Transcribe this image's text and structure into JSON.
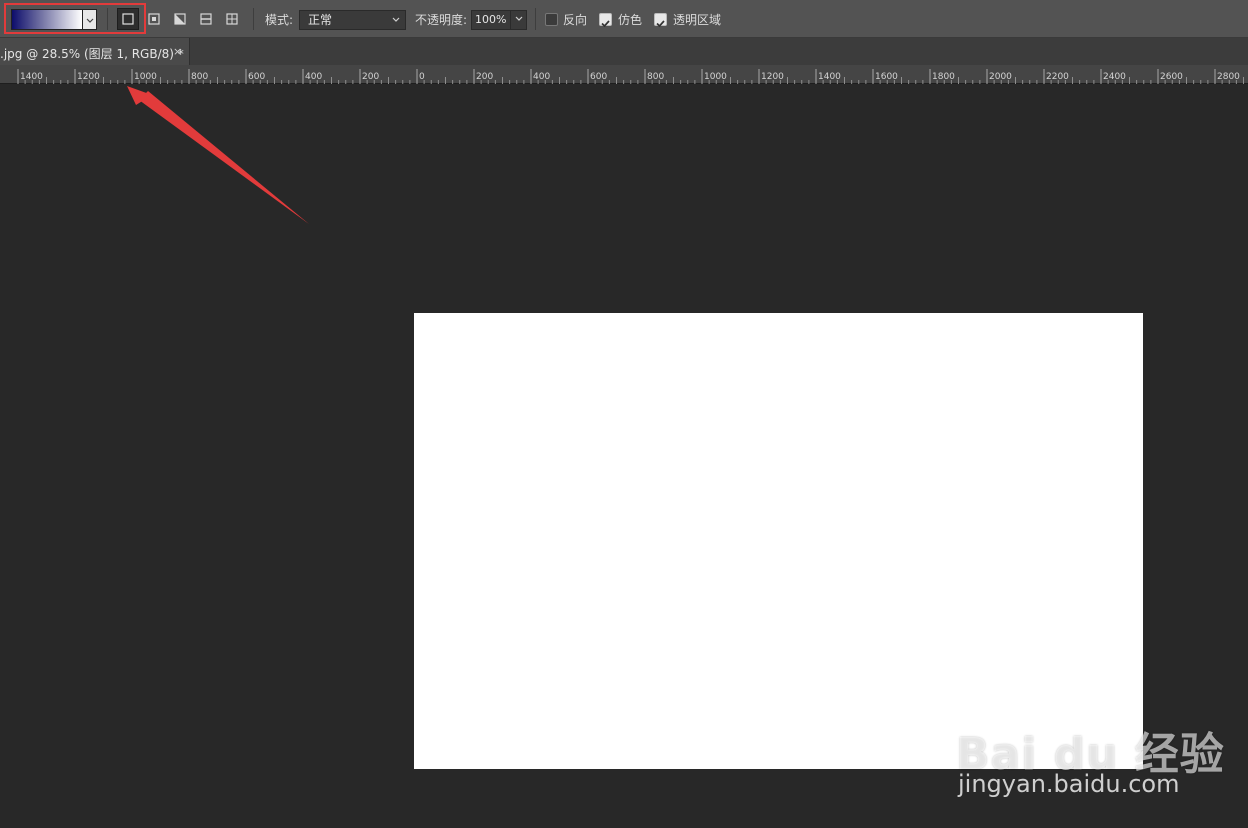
{
  "options_bar": {
    "gradient_preset": "navy-to-white gradient swatch",
    "gradient_colors": [
      "#0d0d6b",
      "#ffffff"
    ],
    "gradient_types": [
      {
        "name": "linear-gradient",
        "active": true
      },
      {
        "name": "radial-gradient",
        "active": false
      },
      {
        "name": "angle-gradient",
        "active": false
      },
      {
        "name": "reflected-gradient",
        "active": false
      },
      {
        "name": "diamond-gradient",
        "active": false
      }
    ],
    "mode_label": "模式:",
    "mode_value": "正常",
    "opacity_label": "不透明度:",
    "opacity_value": "100%",
    "reverse_label": "反向",
    "reverse_checked": false,
    "dither_label": "仿色",
    "dither_checked": true,
    "transparency_label": "透明区域",
    "transparency_checked": true,
    "highlight_color": "#e23b3b"
  },
  "document_tab": {
    "title": ".jpg @ 28.5% (图层 1, RGB/8) *",
    "close": "×"
  },
  "ruler": {
    "labels": [
      "1400",
      "1200",
      "1000",
      "800",
      "600",
      "400",
      "200",
      "0",
      "200",
      "400",
      "600",
      "800",
      "1000",
      "1200",
      "1400",
      "1600",
      "1800",
      "2000",
      "2200",
      "2400",
      "2600",
      "2800"
    ]
  },
  "annotation": {
    "arrow_color": "#e23b3b"
  },
  "watermark": {
    "main": "Bai du 经验",
    "url": "jingyan.baidu.com"
  }
}
